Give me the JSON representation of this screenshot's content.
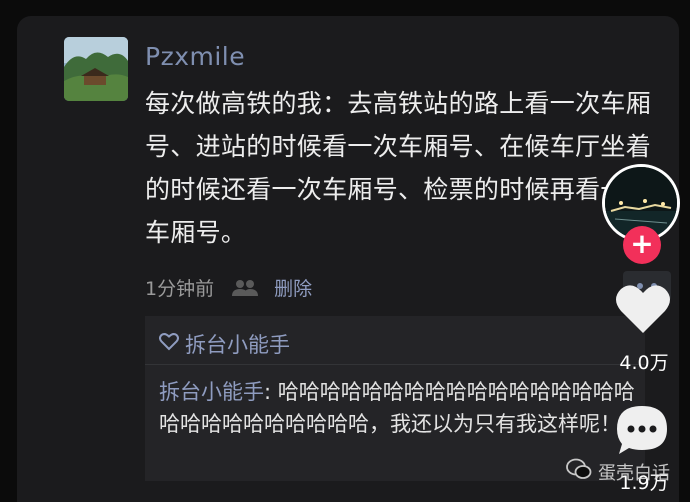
{
  "comment": {
    "username": "Pzxmile",
    "text": "每次做高铁的我：去高铁站的路上看一次车厢号、进站的时候看一次车厢号、在候车厅坐着的时候还看一次车厢号、检票的时候再看一次车厢号。",
    "time": "1分钟前",
    "delete_label": "删除"
  },
  "likes": {
    "names": "拆台小能手"
  },
  "reply": {
    "author": "拆台小能手",
    "separator": ": ",
    "text": "哈哈哈哈哈哈哈哈哈哈哈哈哈哈哈哈哈哈哈哈哈哈哈哈哈哈哈，我还以为只有我这样呢！"
  },
  "rail": {
    "follow_label": "+",
    "like_count": "4.0万",
    "comment_count": "1.9万"
  },
  "watermark": {
    "text": "蛋壳白话"
  },
  "colors": {
    "accent_name": "#7f8fb0",
    "follow": "#f2305a",
    "background": "#0b0b0b",
    "card": "#1b1b1d"
  },
  "icons": [
    "friends-icon",
    "heart-outline-icon",
    "more-icon",
    "heart-icon",
    "comment-icon",
    "wechat-icon"
  ]
}
